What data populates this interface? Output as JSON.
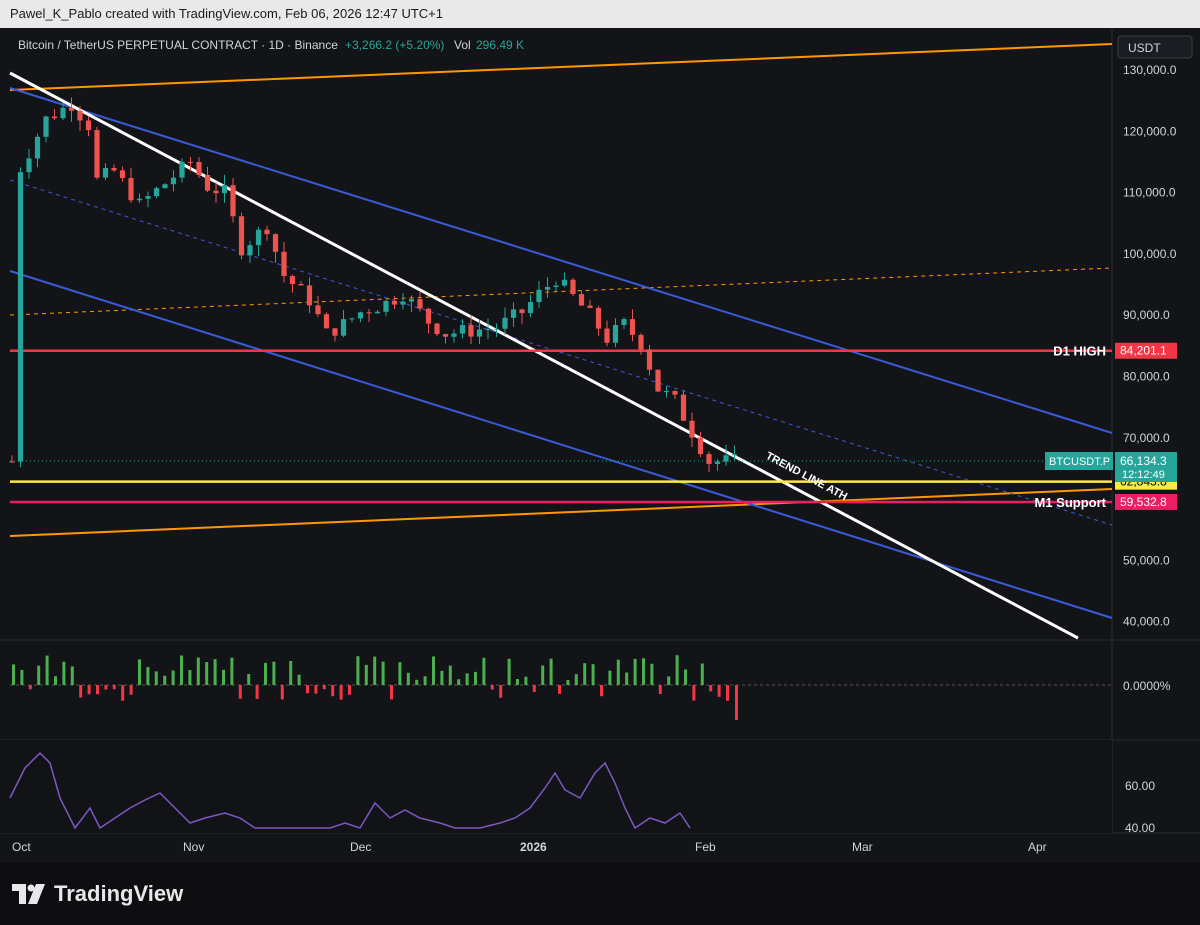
{
  "watermark_text": "Pawel_K_Pablo created with TradingView.com, Feb 06, 2026 12:47 UTC+1",
  "header": {
    "symbol": "Bitcoin / TetherUS PERPETUAL CONTRACT · 1D · Binance",
    "change": "+3,266.2 (+5.20%)",
    "vol_label": "Vol",
    "vol_value": "296.49 K"
  },
  "currency_button": "USDT",
  "brand": "TradingView",
  "colors": {
    "bg": "#131417",
    "up": "#26a69a",
    "down": "#ef5350",
    "vol_up": "#4caf50",
    "vol_down": "#f23645",
    "blue": "#3a5bd9",
    "orange": "#ff9800",
    "white": "#ffffff",
    "red_line": "#f23645",
    "yellow": "#ffeb3b",
    "pink": "#e91e63",
    "rsi": "#7e57c2",
    "price_tag": "#26a69a"
  },
  "chart_data": {
    "type": "candlestick",
    "symbol": "BTCUSDT.P",
    "timeframe": "1D",
    "x_ticks": [
      "Oct",
      "Nov",
      "Dec",
      "2026",
      "Feb",
      "Mar",
      "Apr"
    ],
    "y_ticks": [
      "130,000.0",
      "120,000.0",
      "110,000.0",
      "100,000.0",
      "90,000.0",
      "80,000.0",
      "70,000.0",
      "50,000.0",
      "40,000.0"
    ],
    "ylim": [
      36000,
      134000
    ],
    "close_path": [
      [
        1,
        114000
      ],
      [
        4,
        122000
      ],
      [
        7,
        124500
      ],
      [
        9,
        121000
      ],
      [
        10,
        112000
      ],
      [
        12,
        113500
      ],
      [
        15,
        108000
      ],
      [
        18,
        111500
      ],
      [
        21,
        115000
      ],
      [
        23,
        111000
      ],
      [
        25,
        110000
      ],
      [
        27,
        101000
      ],
      [
        30,
        104500
      ],
      [
        32,
        96500
      ],
      [
        35,
        92500
      ],
      [
        37,
        87000
      ],
      [
        39,
        88500
      ],
      [
        41,
        90500
      ],
      [
        44,
        92000
      ],
      [
        46,
        93500
      ],
      [
        49,
        89000
      ],
      [
        51,
        87000
      ],
      [
        54,
        87500
      ],
      [
        57,
        88000
      ],
      [
        60,
        90500
      ],
      [
        62,
        93500
      ],
      [
        64,
        96000
      ],
      [
        66,
        93000
      ],
      [
        68,
        90000
      ],
      [
        70,
        86200
      ],
      [
        72,
        88500
      ],
      [
        74,
        85500
      ],
      [
        76,
        78000
      ],
      [
        78,
        76000
      ],
      [
        80,
        71000
      ],
      [
        82,
        66134
      ]
    ],
    "horizontal_levels": [
      {
        "label": "D1 HIGH",
        "value": 84201.1,
        "tag": "84,201.1",
        "color": "#f23645"
      },
      {
        "label": "",
        "value": 62843.8,
        "tag": "62,843.8",
        "color": "#ffeb3b"
      },
      {
        "label": "M1 Support",
        "value": 59532.8,
        "tag": "59,532.8",
        "color": "#e91e63"
      }
    ],
    "last_price": {
      "symbol": "BTCUSDT.P",
      "value": "66,134.3",
      "countdown": "12:12:49"
    },
    "annotations": [
      {
        "text": "TREND LINE ATH"
      }
    ],
    "oscillator": {
      "zero_label": "0.0000%"
    },
    "rsi": {
      "ticks": [
        "60.00",
        "40.00"
      ]
    }
  }
}
